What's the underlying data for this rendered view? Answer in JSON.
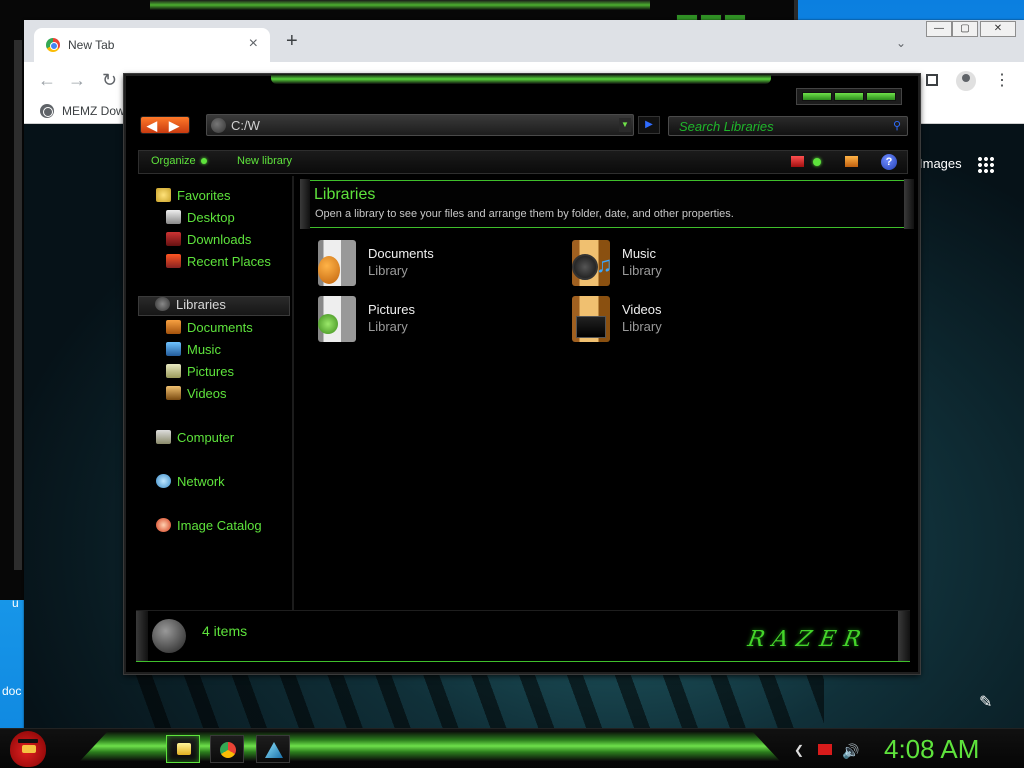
{
  "background_window": {
    "fragments": [
      "u",
      "doc"
    ]
  },
  "chrome": {
    "tab_title": "New Tab",
    "tab_close": "×",
    "new_tab": "+",
    "tab_list": "⌄",
    "minimize": "—",
    "maximize": "▢",
    "close": "✕",
    "back": "←",
    "forward": "→",
    "reload": "↻",
    "bookmark_label": "MEMZ Dow",
    "images_link": "Images",
    "menu": "⋮",
    "edit": "✎"
  },
  "explorer": {
    "address": "C:/W",
    "search_placeholder": "Search Libraries",
    "toolbar": {
      "organize": "Organize",
      "new_library": "New library",
      "help": "?"
    },
    "nav": {
      "favorites": "Favorites",
      "desktop": "Desktop",
      "downloads": "Downloads",
      "recent_places": "Recent Places",
      "libraries": "Libraries",
      "documents": "Documents",
      "music": "Music",
      "pictures": "Pictures",
      "videos": "Videos",
      "computer": "Computer",
      "network": "Network",
      "image_catalog": "Image Catalog"
    },
    "header": {
      "title": "Libraries",
      "subtitle": "Open a library to see your files and arrange them by folder, date, and other properties."
    },
    "libraries": [
      {
        "name": "Documents",
        "type": "Library"
      },
      {
        "name": "Music",
        "type": "Library"
      },
      {
        "name": "Pictures",
        "type": "Library"
      },
      {
        "name": "Videos",
        "type": "Library"
      }
    ],
    "status": {
      "item_count": "4 items",
      "brand": "RAZER"
    }
  },
  "taskbar": {
    "clock": "4:08 AM"
  },
  "colors": {
    "accent_green": "#5ee33c",
    "razer_green": "#44d42a",
    "window_bg": "#000000"
  }
}
